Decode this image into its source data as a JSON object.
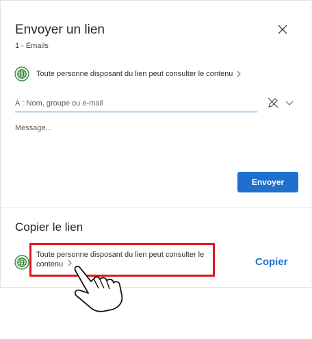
{
  "dialog": {
    "title": "Envoyer un lien",
    "subtitle": "1 - Emails",
    "permission_text": "Toute personne disposant du lien peut consulter le contenu",
    "to_placeholder": "À : Nom, groupe ou e-mail",
    "message_placeholder": "Message...",
    "send_label": "Envoyer"
  },
  "copy_section": {
    "title": "Copier le lien",
    "permission_text": "Toute personne disposant du lien peut consulter le contenu",
    "copy_label": "Copier"
  },
  "icons": {
    "close": "close-icon",
    "globe": "globe-icon",
    "chevron": "chevron-right-icon",
    "pen": "pen-slash-icon",
    "dropdown": "chevron-down-icon",
    "pointer": "hand-pointer-icon"
  },
  "colors": {
    "accent": "#1f6fcc",
    "globe": "#2e7d32",
    "highlight": "#e0161c"
  }
}
